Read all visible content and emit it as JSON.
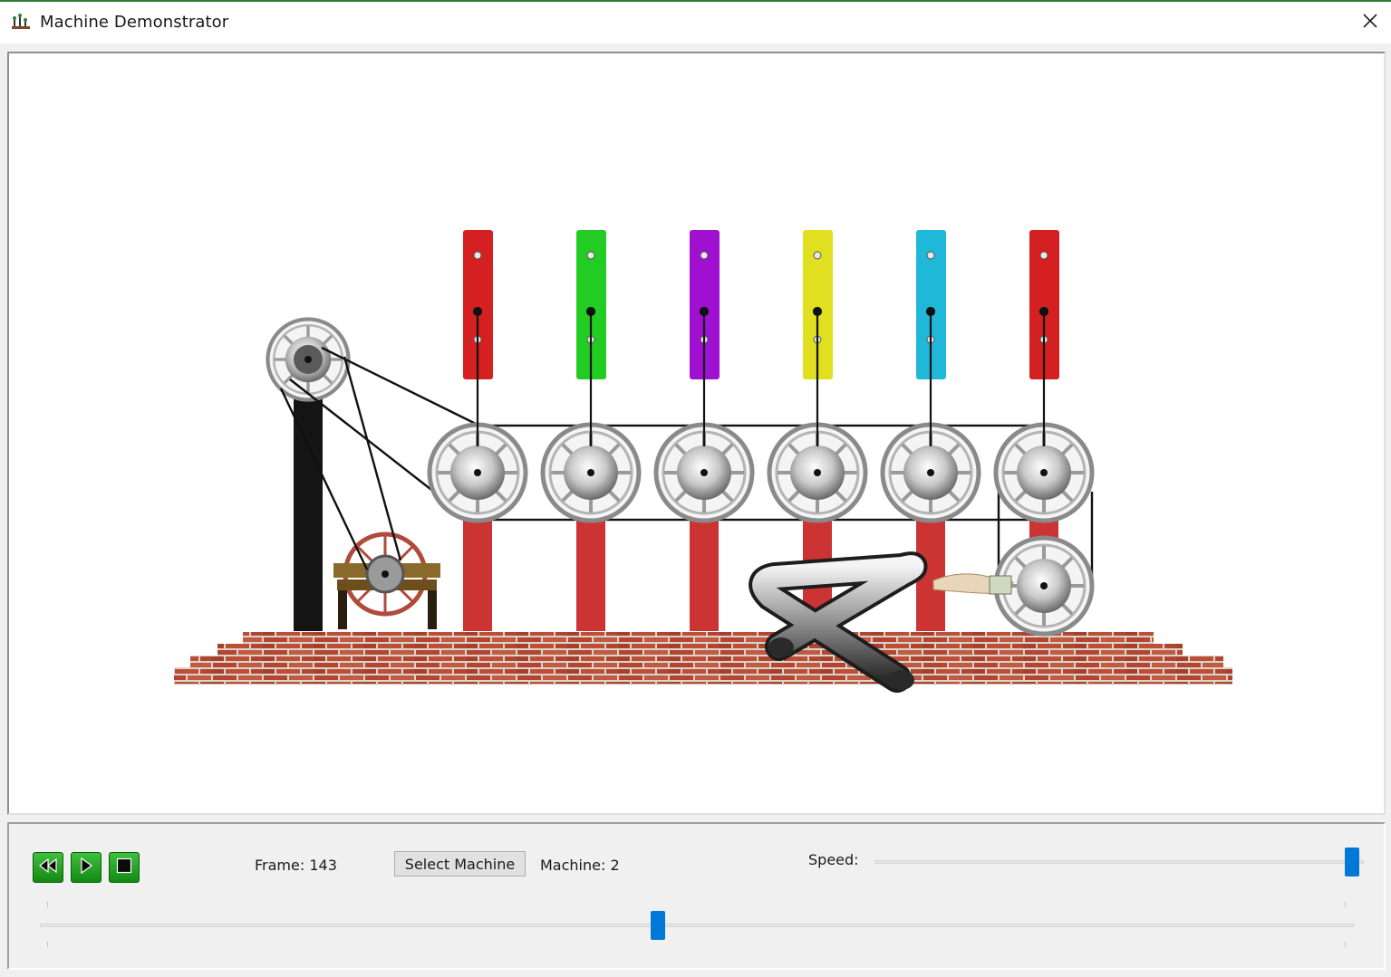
{
  "window": {
    "title": "Machine Demonstrator"
  },
  "icons": {
    "app": "machine-app-icon",
    "close": "close-icon",
    "rewind": "rewind-icon",
    "play": "play-icon",
    "stop": "stop-icon"
  },
  "controls": {
    "frame_label": "Frame: 143",
    "frame_value": 143,
    "select_machine_label": "Select Machine",
    "machine_label": "Machine: 2",
    "machine_value": 2,
    "speed_label": "Speed:",
    "speed_fraction": 0.99,
    "timeline_fraction": 0.47
  },
  "colors": {
    "accent": "#0078d7",
    "media_button": "#1a9a1a",
    "paddles": [
      "#d42020",
      "#22cc22",
      "#a010d0",
      "#e0e020",
      "#20b8d8",
      "#d42020"
    ],
    "posts": "#cc3333",
    "brick": "#b84a35"
  }
}
